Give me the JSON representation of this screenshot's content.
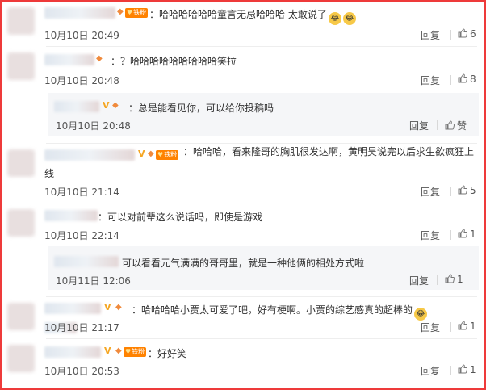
{
  "fan_badge_label": "铁粉",
  "reply_label": "回复",
  "comments": [
    {
      "text": "：哈哈哈哈哈哈童言无忌哈哈哈 太敢说了",
      "time": "10月10日 20:49",
      "likes": "6"
    },
    {
      "text": "：？哈哈哈哈哈哈哈哈哈笑拉",
      "time": "10月10日 20:48",
      "likes": "8"
    },
    {
      "text": "：总是能看见你，可以给你投稿吗",
      "time": "10月10日 20:48",
      "likes": "赞"
    },
    {
      "text": "：哈哈哈，看来隆哥的胸肌很发达啊，黄明昊说完以后求生欲疯狂上线",
      "time": "10月10日 21:14",
      "likes": "5"
    },
    {
      "text": "：可以对前辈这么说话吗，即使是游戏",
      "time": "10月10日 22:14",
      "likes": "1"
    },
    {
      "text": "可以看看元气满满的哥哥里，就是一种他俩的相处方式啦",
      "time": "10月11日 12:06",
      "likes": "1"
    },
    {
      "text": "：哈哈哈哈小贾太可爱了吧，好有梗啊。小贾的综艺感真的超棒的",
      "time": "10月10日 21:17",
      "likes": "1"
    },
    {
      "text": "：好好笑",
      "time": "10月10日 20:53",
      "likes": "1"
    }
  ],
  "icons": {
    "like": "thumbs-up-icon",
    "emoji": "laughing-emoji-icon",
    "verified": "v-badge-icon"
  },
  "colors": {
    "frame": "#ee3a3a",
    "fan_badge": "#ff8200",
    "verified": "#f5a623"
  }
}
